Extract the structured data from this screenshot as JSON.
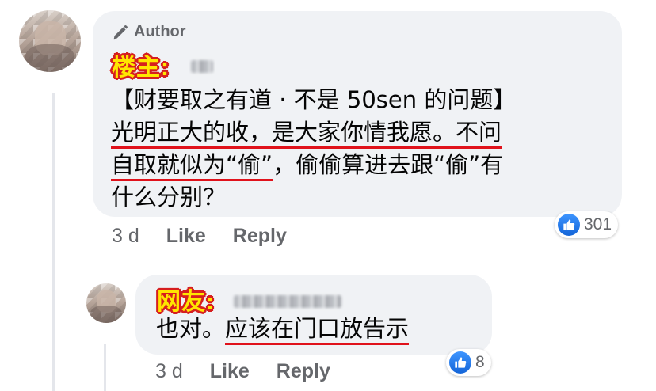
{
  "author_comment": {
    "author_badge": "Author",
    "name_tag": "楼主:",
    "lines": [
      "【财要取之有道 · 不是 50sen 的问题】",
      "光明正大的收，是大家你情我愿。",
      "不问",
      "自取就似为“偷”",
      "，偷偷算进去跟“偷”有",
      "什么分别？"
    ],
    "time": "3 d",
    "like_label": "Like",
    "reply_label": "Reply",
    "reaction_count": "301"
  },
  "reply_comment": {
    "name_tag": "网友:",
    "text_plain": "也对。",
    "text_underlined": "应该在门口放告示",
    "time": "3 d",
    "like_label": "Like",
    "reply_label": "Reply",
    "reaction_count": "8"
  },
  "colors": {
    "bubble": "#f0f2f5",
    "meta_text": "#65676b",
    "highlight_underline": "#e0121b",
    "tag_fill": "#ffe600",
    "tag_outline": "#d61f1f",
    "like_blue": "#1877f2"
  },
  "icons": {
    "author_badge": "pen-icon",
    "reaction": "thumbs-up-icon"
  }
}
